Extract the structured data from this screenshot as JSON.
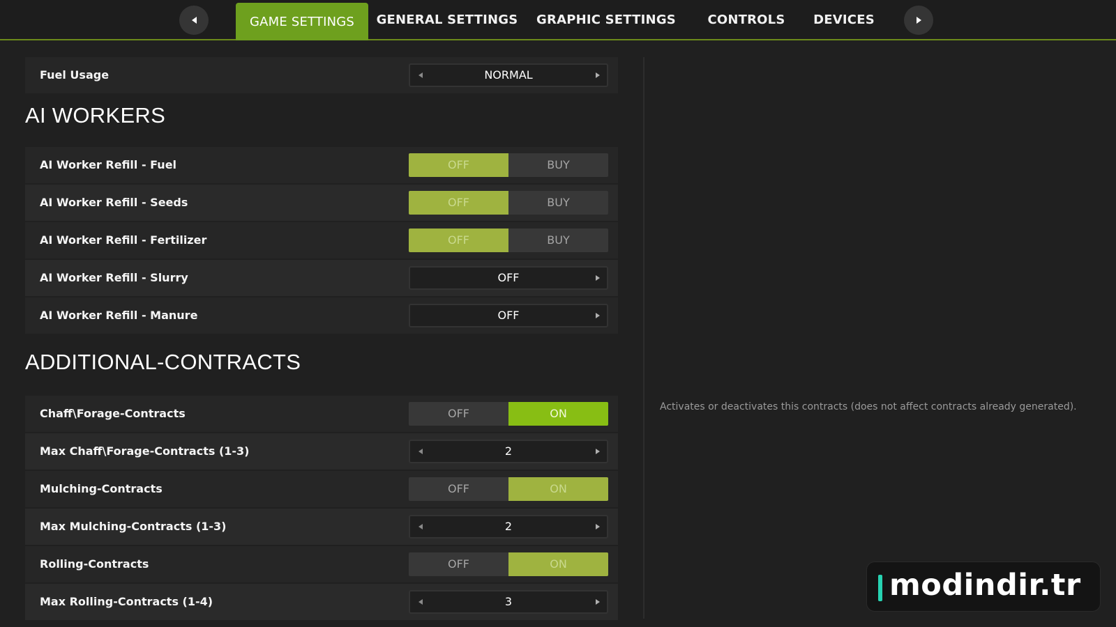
{
  "nav": {
    "prev_icon": "triangle-left-icon",
    "next_icon": "triangle-right-icon",
    "tabs": [
      {
        "label": "GAME SETTINGS",
        "active": true
      },
      {
        "label": "GENERAL SETTINGS",
        "active": false
      },
      {
        "label": "GRAPHIC SETTINGS",
        "active": false
      },
      {
        "label": "CONTROLS",
        "active": false
      },
      {
        "label": "DEVICES",
        "active": false
      }
    ]
  },
  "fuel_usage": {
    "label": "Fuel Usage",
    "value": "NORMAL"
  },
  "sections": {
    "ai_workers": {
      "title": "AI WORKERS",
      "rows": [
        {
          "label": "AI Worker Refill - Fuel",
          "options": [
            "OFF",
            "BUY"
          ],
          "selected": "OFF"
        },
        {
          "label": "AI Worker Refill - Seeds",
          "options": [
            "OFF",
            "BUY"
          ],
          "selected": "OFF"
        },
        {
          "label": "AI Worker Refill - Fertilizer",
          "options": [
            "OFF",
            "BUY"
          ],
          "selected": "OFF"
        },
        {
          "label": "AI Worker Refill - Slurry",
          "value": "OFF"
        },
        {
          "label": "AI Worker Refill - Manure",
          "value": "OFF"
        }
      ]
    },
    "additional_contracts": {
      "title": "ADDITIONAL-CONTRACTS",
      "rows": [
        {
          "label": "Chaff\\Forage-Contracts",
          "options": [
            "OFF",
            "ON"
          ],
          "selected": "ON"
        },
        {
          "label": "Max Chaff\\Forage-Contracts (1-3)",
          "value": "2"
        },
        {
          "label": "Mulching-Contracts",
          "options": [
            "OFF",
            "ON"
          ],
          "selected": "ON"
        },
        {
          "label": "Max Mulching-Contracts (1-3)",
          "value": "2"
        },
        {
          "label": "Rolling-Contracts",
          "options": [
            "OFF",
            "ON"
          ],
          "selected": "ON"
        },
        {
          "label": "Max Rolling-Contracts (1-4)",
          "value": "3"
        }
      ]
    }
  },
  "help": {
    "text": "Activates or deactivates this contracts (does not affect contracts already generated)."
  },
  "watermark": {
    "text": "modindir.tr"
  },
  "colors": {
    "accent": "#6ea01e",
    "toggle_selected": "#9fb340",
    "toggle_selected_bright": "#88be14",
    "watermark_bar": "#27d3b2"
  }
}
